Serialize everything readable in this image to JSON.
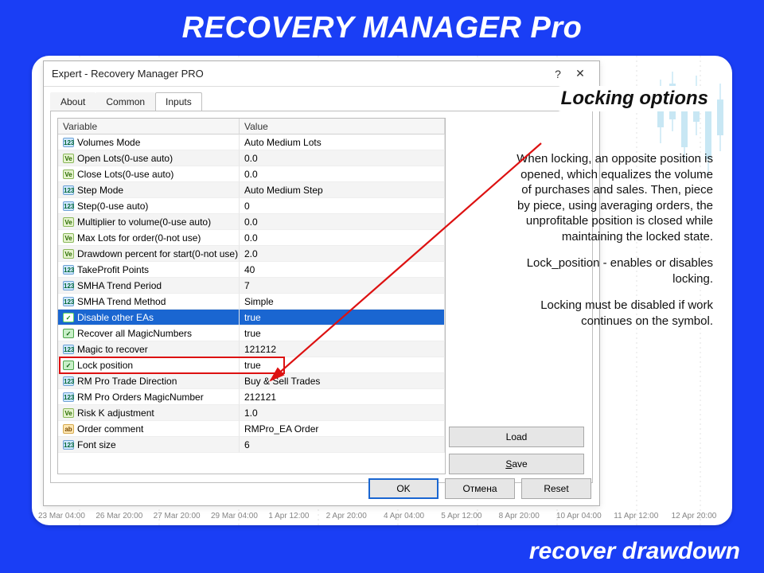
{
  "hero": "RECOVERY MANAGER Pro",
  "footer": "recover drawdown",
  "annotation": {
    "title": "Locking options",
    "p1": "When locking, an opposite position is opened, which equalizes the volume of purchases and sales. Then, piece by piece, using averaging orders, the unprofitable position is closed while maintaining the locked state.",
    "p2": "Lock_position - enables or disables locking.",
    "p3": "Locking must be disabled if work continues on the symbol."
  },
  "dialog": {
    "title": "Expert - Recovery Manager PRO",
    "tabs": {
      "about": "About",
      "common": "Common",
      "inputs": "Inputs"
    },
    "headers": {
      "variable": "Variable",
      "value": "Value"
    },
    "side": {
      "load": "Load",
      "save": "Save",
      "save_ul": "S"
    },
    "buttons": {
      "ok": "OK",
      "cancel": "Отмена",
      "reset": "Reset"
    }
  },
  "rows": [
    {
      "ico": "i",
      "name": "Volumes Mode",
      "value": "Auto Medium Lots"
    },
    {
      "ico": "ve",
      "name": "Open Lots(0-use auto)",
      "value": "0.0"
    },
    {
      "ico": "ve",
      "name": "Close Lots(0-use auto)",
      "value": "0.0"
    },
    {
      "ico": "i",
      "name": "Step Mode",
      "value": "Auto Medium Step"
    },
    {
      "ico": "i",
      "name": "Step(0-use auto)",
      "value": "0"
    },
    {
      "ico": "ve",
      "name": "Multiplier to volume(0-use auto)",
      "value": "0.0"
    },
    {
      "ico": "ve",
      "name": "Max Lots for order(0-not use)",
      "value": "0.0"
    },
    {
      "ico": "ve",
      "name": "Drawdown percent for start(0-not use)",
      "value": "2.0"
    },
    {
      "ico": "i",
      "name": "TakeProfit Points",
      "value": "40"
    },
    {
      "ico": "i",
      "name": "SMHA Trend Period",
      "value": "7"
    },
    {
      "ico": "i",
      "name": "SMHA Trend Method",
      "value": "Simple"
    },
    {
      "ico": "bool",
      "name": "Disable other EAs",
      "value": "true",
      "sel": true
    },
    {
      "ico": "bool",
      "name": "Recover all MagicNumbers",
      "value": "true"
    },
    {
      "ico": "i",
      "name": "Magic to recover",
      "value": "121212"
    },
    {
      "ico": "bool",
      "name": "Lock position",
      "value": "true",
      "hl": true
    },
    {
      "ico": "i",
      "name": "RM Pro Trade Direction",
      "value": "Buy & Sell Trades"
    },
    {
      "ico": "i",
      "name": "RM Pro Orders MagicNumber",
      "value": "212121"
    },
    {
      "ico": "ve",
      "name": "Risk K adjustment",
      "value": "1.0"
    },
    {
      "ico": "str",
      "name": "Order comment",
      "value": "RMPro_EA Order"
    },
    {
      "ico": "i",
      "name": "Font size",
      "value": "6"
    }
  ],
  "timeaxis": [
    "23 Mar 04:00",
    "26 Mar 20:00",
    "27 Mar 20:00",
    "29 Mar 04:00",
    "1 Apr 12:00",
    "2 Apr 20:00",
    "4 Apr 04:00",
    "5 Apr 12:00",
    "8 Apr 20:00",
    "10 Apr 04:00",
    "11 Apr 12:00",
    "12 Apr 20:00"
  ]
}
